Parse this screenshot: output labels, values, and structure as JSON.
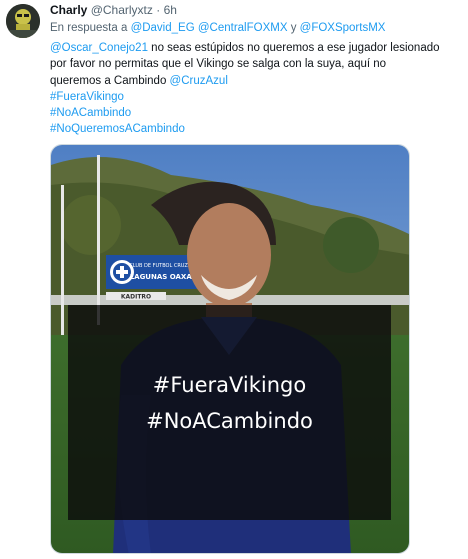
{
  "tweet": {
    "display_name": "Charly",
    "handle": "@Charlyxtz",
    "separator": "·",
    "time": "6h",
    "reply_prefix": "En respuesta a",
    "reply_to": [
      "@David_EG",
      "@CentralFOXMX",
      "@FOXSportsMX"
    ],
    "reply_conjunction": "y",
    "body": {
      "mention_1": "@Oscar_Conejo21",
      "text_1": " no seas estúpidos no queremos a ese jugador lesionado",
      "text_2": "por favor no permitas que el Vikingo se salga con la suya, aquí no",
      "text_3": "queremos a Cambindo ",
      "mention_2": "@CruzAzul",
      "hashtags": [
        "#FueraVikingo",
        "#NoACambindo",
        "#NoQueremosACambindo"
      ]
    },
    "media": {
      "sign_text": [
        "CLUB DE FUTBOL CRUZ AZUL",
        "LAGUNAS OAXACA"
      ],
      "sign_small": "KADITRO",
      "overlay_lines": [
        "#FueraVikingo",
        "#NoACambindo"
      ]
    }
  }
}
